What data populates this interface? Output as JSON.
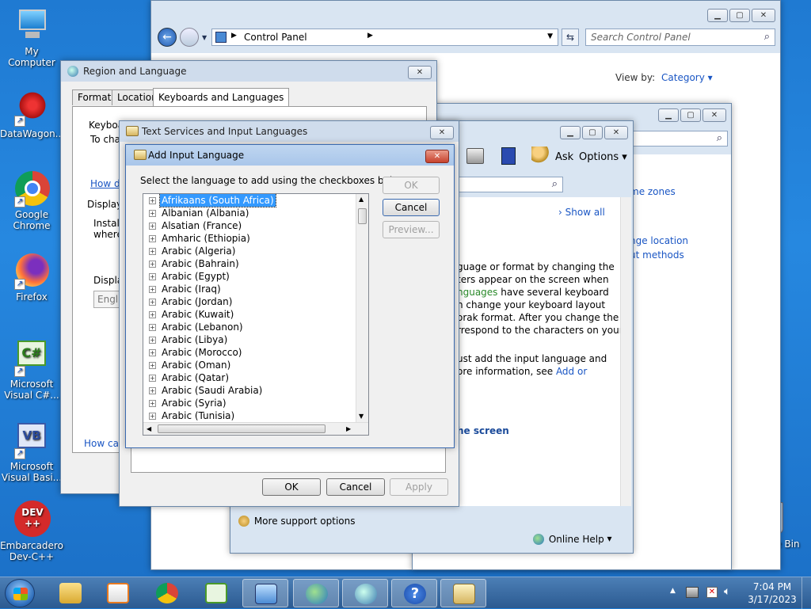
{
  "desktop": {
    "icons": [
      {
        "label": "My Computer"
      },
      {
        "label": "DataWagon..."
      },
      {
        "label": "Google Chrome"
      },
      {
        "label": "Firefox"
      },
      {
        "label": "Microsoft Visual C#..."
      },
      {
        "label": "Microsoft Visual Basi..."
      },
      {
        "label": "Embarcadero Dev-C++"
      },
      {
        "label": "Recycle Bin"
      }
    ]
  },
  "control_panel": {
    "address": "Control Panel",
    "search_placeholder": "Search Control Panel",
    "view_by_label": "View by:",
    "view_by_value": "Category"
  },
  "help_window": {
    "toolbar": {
      "ask": "Ask",
      "options": "Options"
    },
    "show_all": "Show all",
    "links": [
      "me zones",
      "nge location",
      "ut methods"
    ],
    "paragraph1": [
      "guage or format by changing the",
      "ters appear on the screen when",
      "nguages",
      " have several keyboard",
      "n change your keyboard layout",
      "orak format. After you change the",
      "rrespond to the characters on your"
    ],
    "paragraph2": [
      "ust add the input language and",
      "ore information, see ",
      "Add or"
    ],
    "heading": "he screen",
    "more_support": "More support options",
    "online_help": "Online Help"
  },
  "region_dialog": {
    "title": "Region and Language",
    "tabs": [
      "Formats",
      "Location",
      "Keyboards and Languages"
    ],
    "frag": {
      "keyboard": "Keyboa",
      "tochange": "To cha",
      "howdo": "How d",
      "display": "Display",
      "install": "Install",
      "where": "where",
      "displa": "Displa",
      "english": "Englis",
      "howcan": "How can"
    }
  },
  "text_services": {
    "title": "Text Services and Input Languages",
    "ok": "OK",
    "cancel": "Cancel",
    "apply": "Apply"
  },
  "add_input": {
    "title": "Add Input Language",
    "instruction": "Select the language to add using the checkboxes below.",
    "ok": "OK",
    "cancel": "Cancel",
    "preview": "Preview...",
    "languages": [
      "Afrikaans (South Africa)",
      "Albanian (Albania)",
      "Alsatian (France)",
      "Amharic (Ethiopia)",
      "Arabic (Algeria)",
      "Arabic (Bahrain)",
      "Arabic (Egypt)",
      "Arabic (Iraq)",
      "Arabic (Jordan)",
      "Arabic (Kuwait)",
      "Arabic (Lebanon)",
      "Arabic (Libya)",
      "Arabic (Morocco)",
      "Arabic (Oman)",
      "Arabic (Qatar)",
      "Arabic (Saudi Arabia)",
      "Arabic (Syria)",
      "Arabic (Tunisia)"
    ]
  },
  "taskbar": {
    "time": "7:04 PM",
    "date": "3/17/2023"
  }
}
